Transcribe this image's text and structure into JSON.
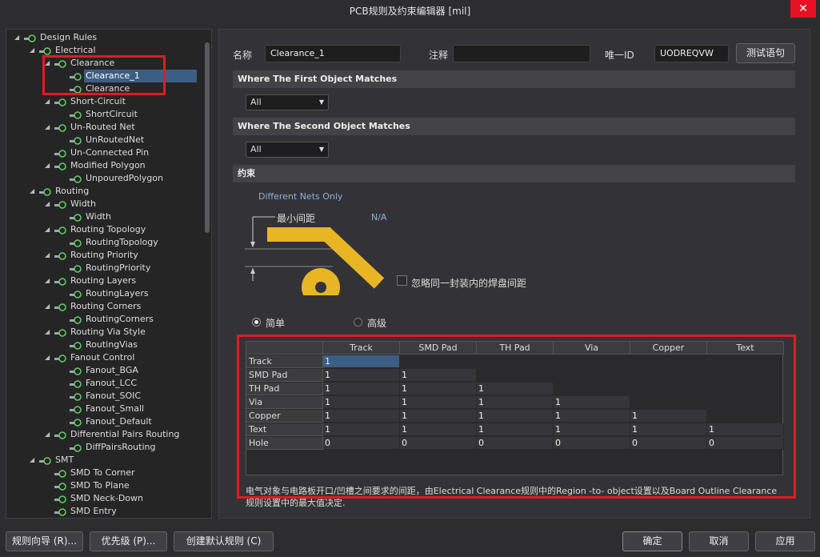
{
  "window": {
    "title": "PCB规则及约束编辑器 [mil]",
    "close": "✕"
  },
  "tree": {
    "items": [
      {
        "label": "Design Rules",
        "arrow": "◢",
        "indent": 0,
        "icon": "rules-root-icon"
      },
      {
        "label": "Electrical",
        "arrow": "◢",
        "indent": 1,
        "icon": "electrical-icon"
      },
      {
        "label": "Clearance",
        "arrow": "◢",
        "indent": 2,
        "icon": "clearance-icon"
      },
      {
        "label": "Clearance_1",
        "arrow": "",
        "indent": 3,
        "icon": "clearance-rule-icon",
        "selected": true
      },
      {
        "label": "Clearance",
        "arrow": "",
        "indent": 3,
        "icon": "clearance-rule-icon"
      },
      {
        "label": "Short-Circuit",
        "arrow": "◢",
        "indent": 2,
        "icon": "short-circuit-icon"
      },
      {
        "label": "ShortCircuit",
        "arrow": "",
        "indent": 3,
        "icon": "short-circuit-rule-icon"
      },
      {
        "label": "Un-Routed Net",
        "arrow": "◢",
        "indent": 2,
        "icon": "unrouted-net-icon"
      },
      {
        "label": "UnRoutedNet",
        "arrow": "",
        "indent": 3,
        "icon": "unrouted-net-rule-icon"
      },
      {
        "label": "Un-Connected Pin",
        "arrow": "",
        "indent": 2,
        "icon": "unconnected-pin-icon"
      },
      {
        "label": "Modified Polygon",
        "arrow": "◢",
        "indent": 2,
        "icon": "modified-polygon-icon"
      },
      {
        "label": "UnpouredPolygon",
        "arrow": "",
        "indent": 3,
        "icon": "unpoured-polygon-icon"
      },
      {
        "label": "Routing",
        "arrow": "◢",
        "indent": 1,
        "icon": "routing-icon"
      },
      {
        "label": "Width",
        "arrow": "◢",
        "indent": 2,
        "icon": "width-icon"
      },
      {
        "label": "Width",
        "arrow": "",
        "indent": 3,
        "icon": "width-rule-icon"
      },
      {
        "label": "Routing Topology",
        "arrow": "◢",
        "indent": 2,
        "icon": "routing-topology-icon"
      },
      {
        "label": "RoutingTopology",
        "arrow": "",
        "indent": 3,
        "icon": "routing-topology-rule-icon"
      },
      {
        "label": "Routing Priority",
        "arrow": "◢",
        "indent": 2,
        "icon": "routing-priority-icon"
      },
      {
        "label": "RoutingPriority",
        "arrow": "",
        "indent": 3,
        "icon": "routing-priority-rule-icon"
      },
      {
        "label": "Routing Layers",
        "arrow": "◢",
        "indent": 2,
        "icon": "routing-layers-icon"
      },
      {
        "label": "RoutingLayers",
        "arrow": "",
        "indent": 3,
        "icon": "routing-layers-rule-icon"
      },
      {
        "label": "Routing Corners",
        "arrow": "◢",
        "indent": 2,
        "icon": "routing-corners-icon"
      },
      {
        "label": "RoutingCorners",
        "arrow": "",
        "indent": 3,
        "icon": "routing-corners-rule-icon"
      },
      {
        "label": "Routing Via Style",
        "arrow": "◢",
        "indent": 2,
        "icon": "routing-via-style-icon"
      },
      {
        "label": "RoutingVias",
        "arrow": "",
        "indent": 3,
        "icon": "routing-vias-rule-icon"
      },
      {
        "label": "Fanout Control",
        "arrow": "◢",
        "indent": 2,
        "icon": "fanout-control-icon"
      },
      {
        "label": "Fanout_BGA",
        "arrow": "",
        "indent": 3,
        "icon": "fanout-rule-icon"
      },
      {
        "label": "Fanout_LCC",
        "arrow": "",
        "indent": 3,
        "icon": "fanout-rule-icon"
      },
      {
        "label": "Fanout_SOIC",
        "arrow": "",
        "indent": 3,
        "icon": "fanout-rule-icon"
      },
      {
        "label": "Fanout_Small",
        "arrow": "",
        "indent": 3,
        "icon": "fanout-rule-icon"
      },
      {
        "label": "Fanout_Default",
        "arrow": "",
        "indent": 3,
        "icon": "fanout-rule-icon"
      },
      {
        "label": "Differential Pairs Routing",
        "arrow": "◢",
        "indent": 2,
        "icon": "diff-pairs-icon"
      },
      {
        "label": "DiffPairsRouting",
        "arrow": "",
        "indent": 3,
        "icon": "diff-pairs-rule-icon"
      },
      {
        "label": "SMT",
        "arrow": "◢",
        "indent": 1,
        "icon": "smt-icon"
      },
      {
        "label": "SMD To Corner",
        "arrow": "",
        "indent": 2,
        "icon": "smd-icon"
      },
      {
        "label": "SMD To Plane",
        "arrow": "",
        "indent": 2,
        "icon": "smd-icon"
      },
      {
        "label": "SMD Neck-Down",
        "arrow": "",
        "indent": 2,
        "icon": "smd-icon"
      },
      {
        "label": "SMD Entry",
        "arrow": "",
        "indent": 2,
        "icon": "smd-icon"
      }
    ]
  },
  "form": {
    "name_label": "名称",
    "name_value": "Clearance_1",
    "comment_label": "注释",
    "comment_value": "",
    "id_label": "唯一ID",
    "id_value": "UODREQVW",
    "test_button": "测试语句"
  },
  "first_match": {
    "title": "Where The First Object Matches",
    "value": "All"
  },
  "second_match": {
    "title": "Where The Second Object Matches",
    "value": "All"
  },
  "constraints": {
    "title": "约束",
    "nets": "Different Nets Only",
    "min_clearance_label": "最小间距",
    "min_clearance_value": "N/A",
    "ignore_pad_label": "忽略同一封装内的焊盘间距",
    "mode_simple": "简单",
    "mode_advanced": "高级"
  },
  "matrix": {
    "columns": [
      "Track",
      "SMD Pad",
      "TH Pad",
      "Via",
      "Copper",
      "Text"
    ],
    "rows": [
      {
        "name": "Track",
        "values": [
          "1"
        ]
      },
      {
        "name": "SMD Pad",
        "values": [
          "1",
          "1"
        ]
      },
      {
        "name": "TH Pad",
        "values": [
          "1",
          "1",
          "1"
        ]
      },
      {
        "name": "Via",
        "values": [
          "1",
          "1",
          "1",
          "1"
        ]
      },
      {
        "name": "Copper",
        "values": [
          "1",
          "1",
          "1",
          "1",
          "1"
        ]
      },
      {
        "name": "Text",
        "values": [
          "1",
          "1",
          "1",
          "1",
          "1",
          "1"
        ]
      },
      {
        "name": "Hole",
        "values": [
          "0",
          "0",
          "0",
          "0",
          "0",
          "0"
        ]
      }
    ]
  },
  "description": {
    "line1": "电气对象与电路板开口/凹槽之间要求的间距，由Electrical Clearance规则中的Region -to- object设置以及Board Outline Clearance",
    "line2": "规则设置中的最大值决定."
  },
  "footer": {
    "wizard": "规则向导 (R)...",
    "priority": "优先级 (P)...",
    "create_default": "创建默认规则 (C)",
    "ok": "确定",
    "cancel": "取消",
    "apply": "应用"
  },
  "colors": {
    "accent": "#e8b624",
    "selection": "#3c5e83",
    "highlight_box": "#e11b22"
  }
}
